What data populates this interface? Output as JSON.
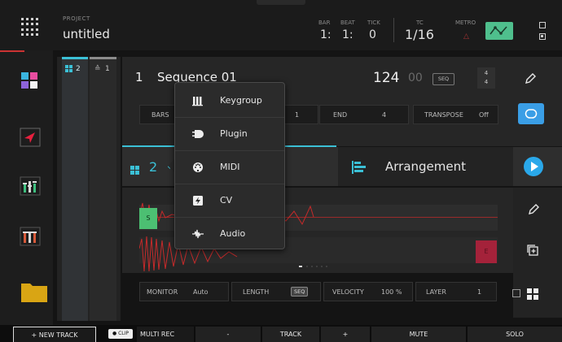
{
  "header": {
    "project_caption": "PROJECT",
    "project_name": "untitled",
    "bar_label": "BAR",
    "bar_value": "1:",
    "beat_label": "BEAT",
    "beat_value": "1:",
    "tick_label": "TICK",
    "tick_value": "0",
    "tc_label": "TC",
    "tc_value": "1/16",
    "metro_label": "METRO",
    "metro_value": "△"
  },
  "track_tabs": {
    "tab_a": "2",
    "tab_b": "1"
  },
  "sequence": {
    "number": "1",
    "name": "Sequence 01",
    "bpm": "124",
    "bpm_decimal": "00",
    "seq_badge": "SEQ",
    "time_sig_top": "4",
    "time_sig_bottom": "4",
    "params": {
      "bars_label": "BARS",
      "start_value": "1",
      "end_label": "END",
      "end_value": "4",
      "transpose_label": "TRANSPOSE",
      "transpose_value": "Off"
    }
  },
  "track": {
    "number": "2",
    "arrangement_label": "Arrangement"
  },
  "clip": {
    "start_marker": "S",
    "end_marker": "E"
  },
  "bottom_params": {
    "monitor_label": "MONITOR",
    "monitor_value": "Auto",
    "length_label": "LENGTH",
    "length_value": "SEQ",
    "velocity_label": "VELOCITY",
    "velocity_value": "100 %",
    "layer_label": "LAYER",
    "layer_value": "1"
  },
  "bottom_bar": {
    "new_track": "+   NEW TRACK",
    "clip_chip": "● CLIP",
    "multi_rec": "MULTI REC",
    "minus": "-",
    "track": "TRACK",
    "plus": "+",
    "mute": "MUTE",
    "solo": "SOLO"
  },
  "track_type_menu": {
    "items": [
      {
        "label": "Keygroup",
        "icon": "keygroup-icon"
      },
      {
        "label": "Plugin",
        "icon": "plugin-icon"
      },
      {
        "label": "MIDI",
        "icon": "midi-icon"
      },
      {
        "label": "CV",
        "icon": "cv-icon"
      },
      {
        "label": "Audio",
        "icon": "audio-icon"
      }
    ]
  },
  "colors": {
    "accent_cyan": "#3bc0d6",
    "loop_blue": "#3a9ee6",
    "automation_green": "#4fbf8d",
    "clip_start_green": "#4cbf72",
    "clip_end_red": "#a4223a",
    "waveform_red": "#c62a2a"
  }
}
